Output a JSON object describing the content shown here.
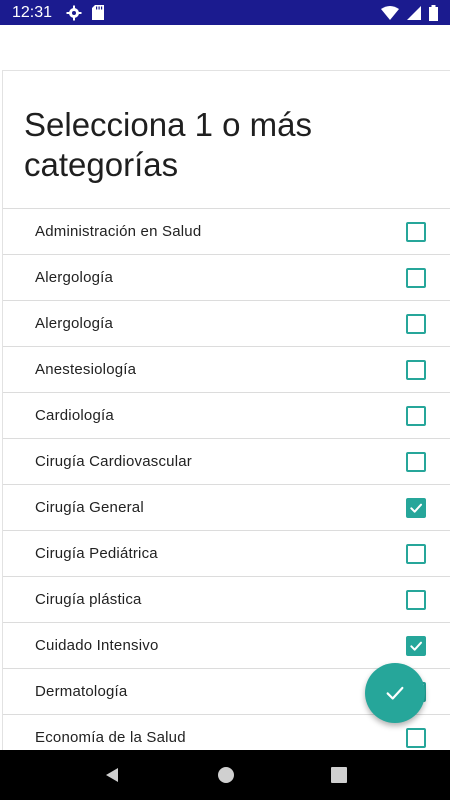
{
  "status_bar": {
    "time": "12:31",
    "icons_left": [
      "gear-icon",
      "sd-card-icon"
    ],
    "icons_right": [
      "wifi-icon",
      "signal-icon",
      "battery-icon"
    ]
  },
  "dialog": {
    "title": "Selecciona 1 o más categorías"
  },
  "categories": [
    {
      "label": "Administración en Salud",
      "checked": false
    },
    {
      "label": "Alergología",
      "checked": false
    },
    {
      "label": "Alergología",
      "checked": false
    },
    {
      "label": "Anestesiología",
      "checked": false
    },
    {
      "label": "Cardiología",
      "checked": false
    },
    {
      "label": "Cirugía Cardiovascular",
      "checked": false
    },
    {
      "label": "Cirugía General",
      "checked": true
    },
    {
      "label": "Cirugía Pediátrica",
      "checked": false
    },
    {
      "label": "Cirugía plástica",
      "checked": false
    },
    {
      "label": "Cuidado Intensivo",
      "checked": true
    },
    {
      "label": "Dermatología",
      "checked": false
    },
    {
      "label": "Economía de la Salud",
      "checked": false
    }
  ],
  "fab": {
    "icon": "check-icon"
  },
  "nav_bar": {
    "icons": [
      "back-icon",
      "home-icon",
      "recents-icon"
    ]
  },
  "colors": {
    "accent": "#26a69a",
    "status_bar": "#1b1b8f"
  }
}
